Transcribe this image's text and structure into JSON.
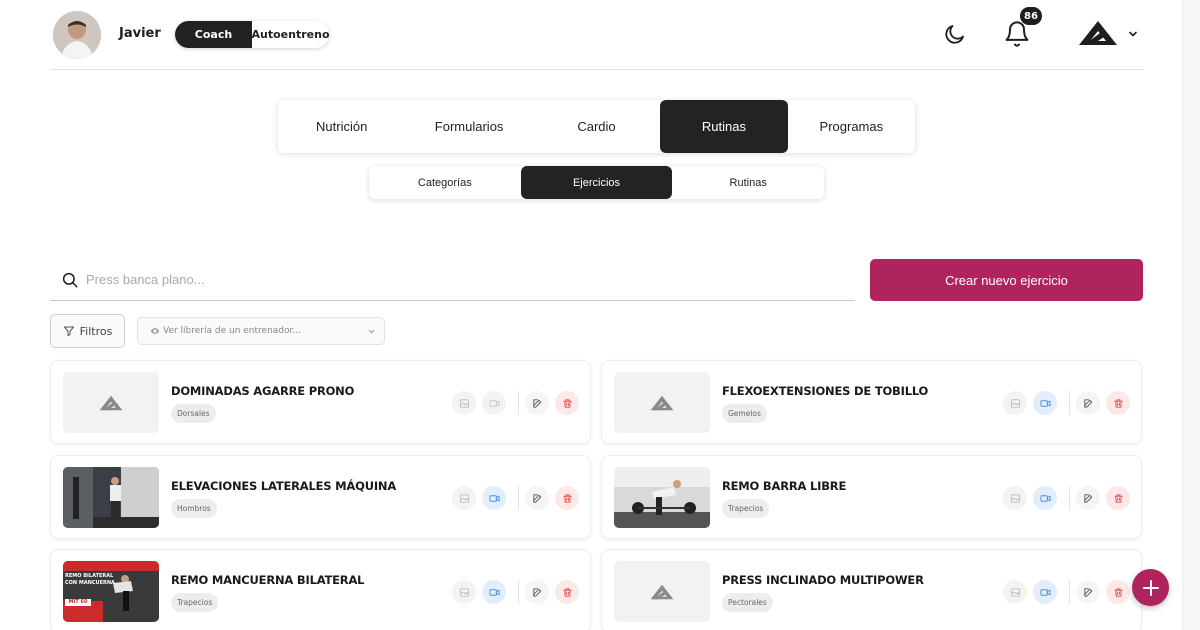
{
  "header": {
    "user_name": "Javier",
    "mode_toggle": {
      "coach_label": "Coach",
      "self_label": "Autoentreno",
      "selected": "Coach"
    },
    "notifications_count": "86"
  },
  "main_tabs": [
    {
      "label": "Nutrición",
      "active": false
    },
    {
      "label": "Formularios",
      "active": false
    },
    {
      "label": "Cardio",
      "active": false
    },
    {
      "label": "Rutinas",
      "active": true
    },
    {
      "label": "Programas",
      "active": false
    }
  ],
  "sub_tabs": [
    {
      "label": "Categorías",
      "active": false
    },
    {
      "label": "Ejercicios",
      "active": true
    },
    {
      "label": "Rutinas",
      "active": false
    }
  ],
  "search": {
    "placeholder": "Press banca plano..."
  },
  "create_button_label": "Crear nuevo ejercicio",
  "filters": {
    "filters_label": "Filtros",
    "library_placeholder": "Ver librería de un entrenador..."
  },
  "exercises": [
    {
      "title": "DOMINADAS AGARRE PRONO",
      "tag": "Dorsales",
      "has_video": false
    },
    {
      "title": "FLEXOEXTENSIONES DE TOBILLO",
      "tag": "Gemelos",
      "has_video": true
    },
    {
      "title": "ELEVACIONES LATERALES MÁQUINA",
      "tag": "Hombros",
      "has_video": true
    },
    {
      "title": "REMO BARRA LIBRE",
      "tag": "Trapecios",
      "has_video": true
    },
    {
      "title": "REMO MANCUERNA BILATERAL",
      "tag": "Trapecios",
      "has_video": true,
      "thumb_text": [
        "REMO BILATERAL",
        "CON MANCUERNA",
        "MIT 60"
      ]
    },
    {
      "title": "PRESS INCLINADO MULTIPOWER",
      "tag": "Pectorales",
      "has_video": true
    }
  ],
  "colors": {
    "accent": "#b0245e",
    "dark": "#232323",
    "video_on_bg": "#e3eefc",
    "video_on_icon": "#4a8fe0",
    "delete_bg": "#fde7e7",
    "delete_icon": "#d84a4a"
  }
}
